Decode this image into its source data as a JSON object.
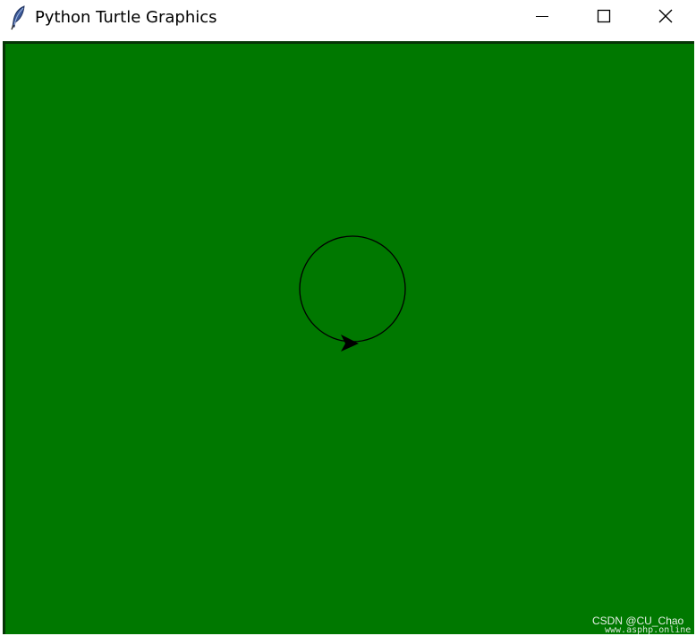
{
  "window": {
    "title": "Python Turtle Graphics",
    "icon": "feather-icon",
    "controls": {
      "minimize_icon": "minimize-icon",
      "maximize_icon": "maximize-icon",
      "close_icon": "close-icon"
    }
  },
  "canvas": {
    "background_color": "#007800",
    "pen_color": "#000000",
    "shape": "circle",
    "turtle_icon": "turtle-arrow-icon"
  },
  "watermark": {
    "line1": "CSDN @CU_Chao",
    "line2": "www.asphp.online"
  }
}
